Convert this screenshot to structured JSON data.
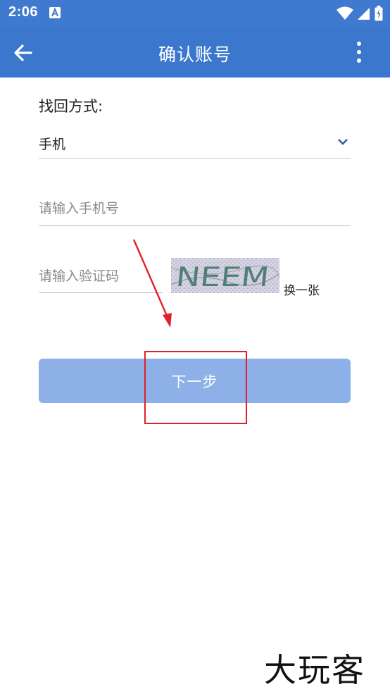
{
  "status_bar": {
    "time": "2:06",
    "app_icon": "a-letter-icon",
    "icons": [
      "wifi-icon",
      "signal-icon",
      "battery-icon"
    ]
  },
  "app_bar": {
    "title": "确认账号",
    "back_icon": "arrow-left-icon",
    "more_icon": "more-vertical-icon",
    "color": "#3b78cd"
  },
  "form": {
    "method_label": "找回方式:",
    "method_value": "手机",
    "phone_placeholder": "请输入手机号",
    "code_placeholder": "请输入验证码",
    "captcha_text": "NEEM",
    "refresh_label": "换一张",
    "next_label": "下一步",
    "next_button_color": "#8db0e8"
  },
  "annotation": {
    "highlight_color": "#e0202a"
  },
  "watermark": "大玩客"
}
